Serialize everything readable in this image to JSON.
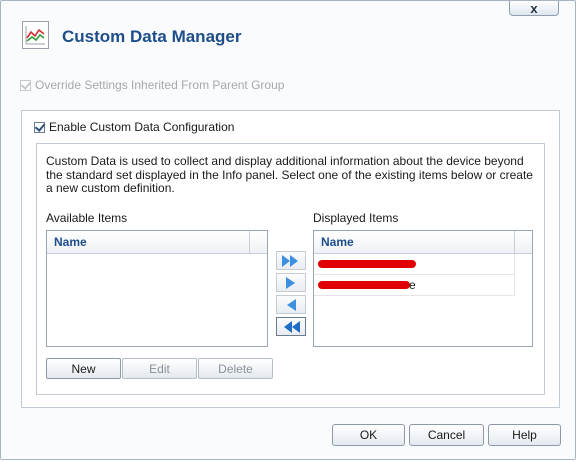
{
  "window": {
    "title": "Custom Data Manager",
    "close_label": "x"
  },
  "override_settings": {
    "label": "Override Settings Inherited From Parent Group",
    "checked": true,
    "disabled": true
  },
  "enable_config": {
    "label": "Enable Custom Data Configuration",
    "checked": true
  },
  "description": "Custom Data is used to collect and display additional information about the device beyond the standard set displayed in the Info panel. Select one of the existing items below or create a new custom definition.",
  "available": {
    "label": "Available Items",
    "column_header": "Name",
    "rows": []
  },
  "displayed": {
    "label": "Displayed Items",
    "column_header": "Name",
    "rows": [
      {
        "text": "",
        "redacted": true
      },
      {
        "text": "e",
        "redacted": true
      }
    ]
  },
  "transfer_buttons": [
    {
      "name": "move-all-right-button",
      "icon": "double-arrow-right-icon",
      "enabled": true
    },
    {
      "name": "move-right-button",
      "icon": "arrow-right-icon",
      "enabled": true
    },
    {
      "name": "move-left-button",
      "icon": "arrow-left-icon",
      "enabled": true
    },
    {
      "name": "move-all-left-button",
      "icon": "double-arrow-left-icon",
      "enabled": true
    }
  ],
  "item_buttons": {
    "new": "New",
    "edit": "Edit",
    "delete": "Delete"
  },
  "dialog_buttons": {
    "ok": "OK",
    "cancel": "Cancel",
    "help": "Help"
  },
  "colors": {
    "title": "#1d4e8a",
    "header_text": "#1d4e8a",
    "arrow": "#3d8fe0",
    "redaction": "#e00000"
  }
}
